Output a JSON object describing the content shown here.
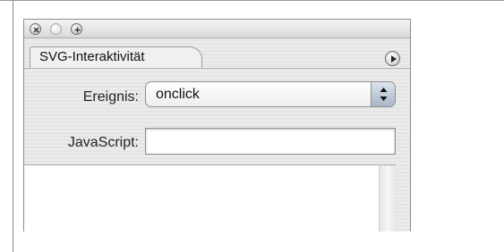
{
  "panel": {
    "tab_label": "SVG-Interaktivität"
  },
  "event": {
    "label": "Ereignis:",
    "value": "onclick"
  },
  "javascript": {
    "label": "JavaScript:",
    "value": ""
  },
  "icons": {
    "close": "close-icon",
    "minimize": "minimize-icon",
    "zoom": "zoom-icon",
    "menu": "play-triangle-icon",
    "select_arrows": "up-down-arrows-icon"
  }
}
